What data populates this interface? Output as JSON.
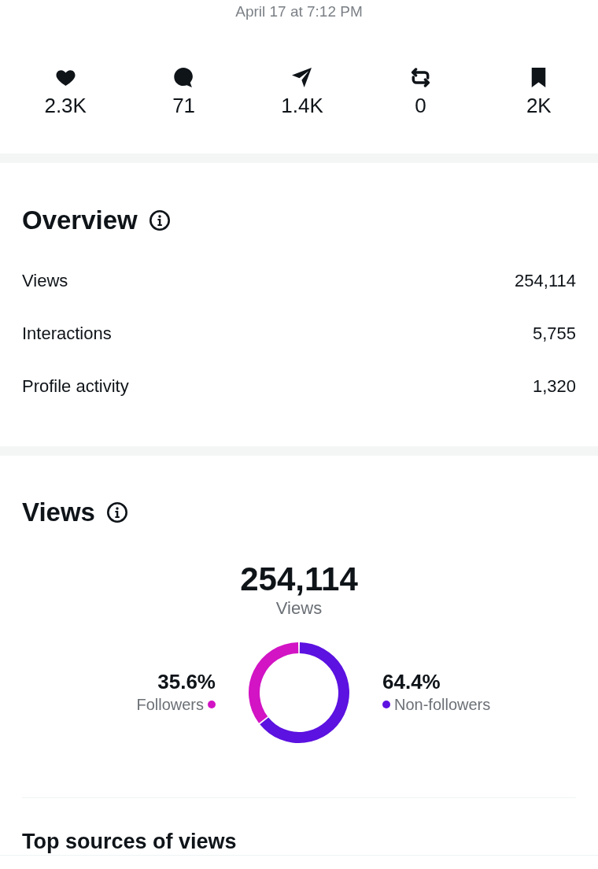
{
  "timestamp": "April 17 at 7:12 PM",
  "engagement": [
    {
      "kind": "like",
      "value": "2.3K"
    },
    {
      "kind": "reply",
      "value": "71"
    },
    {
      "kind": "share",
      "value": "1.4K"
    },
    {
      "kind": "repost",
      "value": "0"
    },
    {
      "kind": "bookmark",
      "value": "2K"
    }
  ],
  "overview": {
    "title": "Overview",
    "rows": [
      {
        "label": "Views",
        "value": "254,114"
      },
      {
        "label": "Interactions",
        "value": "5,755"
      },
      {
        "label": "Profile activity",
        "value": "1,320"
      }
    ]
  },
  "views": {
    "title": "Views",
    "total": "254,114",
    "total_label": "Views",
    "segments": [
      {
        "percent": "35.6%",
        "color": "#d214c4"
      },
      {
        "percent": "64.4%",
        "color": "#5c12e0"
      }
    ],
    "chart_data": {
      "type": "donut",
      "categories": [
        "Followers",
        "Non-followers"
      ],
      "values": [
        35.6,
        64.4
      ]
    }
  },
  "top_sources": {
    "title": "Top sources of views"
  }
}
